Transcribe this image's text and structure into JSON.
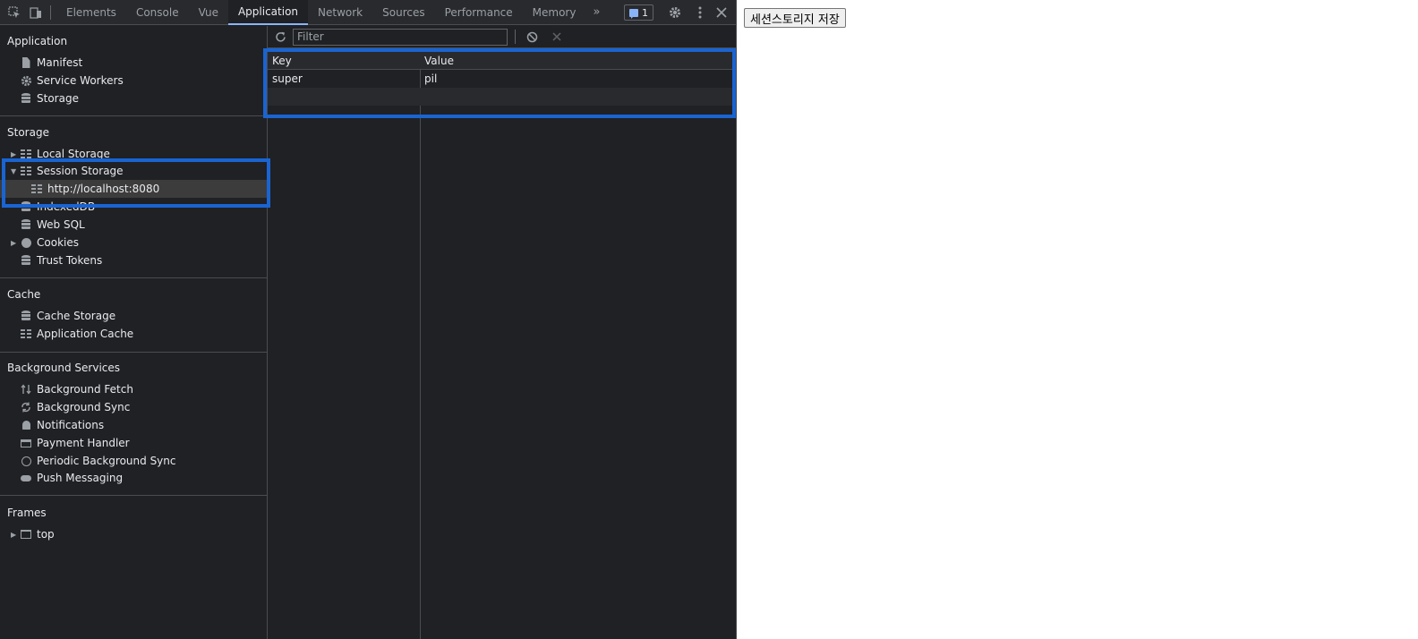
{
  "devtools": {
    "tabs": [
      "Elements",
      "Console",
      "Vue",
      "Application",
      "Network",
      "Sources",
      "Performance",
      "Memory"
    ],
    "active_tab": "Application",
    "more_tabs_glyph": "»",
    "issues_count": "1",
    "accent_color": "#8ab4f8",
    "highlight_color": "#1a64d2"
  },
  "sidebar": {
    "application": {
      "title": "Application",
      "items": [
        "Manifest",
        "Service Workers",
        "Storage"
      ]
    },
    "storage": {
      "title": "Storage",
      "items": [
        "Local Storage",
        "Session Storage",
        "IndexedDB",
        "Web SQL",
        "Cookies",
        "Trust Tokens"
      ],
      "session_origin": "http://localhost:8080"
    },
    "cache": {
      "title": "Cache",
      "items": [
        "Cache Storage",
        "Application Cache"
      ]
    },
    "background": {
      "title": "Background Services",
      "items": [
        "Background Fetch",
        "Background Sync",
        "Notifications",
        "Payment Handler",
        "Periodic Background Sync",
        "Push Messaging"
      ]
    },
    "frames": {
      "title": "Frames",
      "items": [
        "top"
      ]
    }
  },
  "main": {
    "filter": {
      "placeholder": "Filter",
      "value": ""
    },
    "table": {
      "headers": [
        "Key",
        "Value"
      ],
      "rows": [
        {
          "key": "super",
          "value": "pil"
        }
      ]
    }
  },
  "page": {
    "button_label": "세션스토리지 저장"
  }
}
